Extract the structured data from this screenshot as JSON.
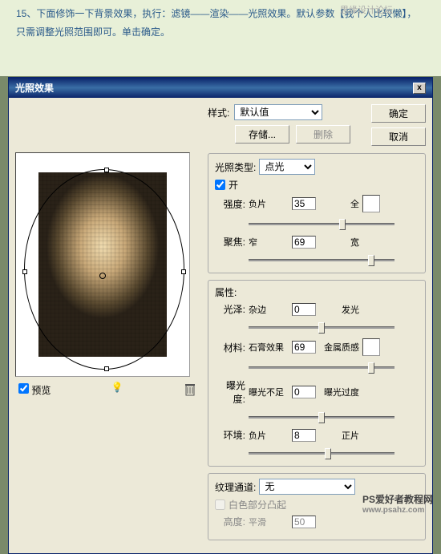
{
  "instruction_text": "15、下面修饰一下背景效果，执行：滤镜——渲染——光照效果。默认参数【我个人比较懒】，只需调整光照范围即可。单击确定。",
  "watermark_top": "思缘设计论坛",
  "dialog": {
    "title": "光照效果",
    "close": "x",
    "style_label": "样式:",
    "style_value": "默认值",
    "save_btn": "存储...",
    "delete_btn": "删除",
    "ok_btn": "确定",
    "cancel_btn": "取消",
    "light_type_label": "光照类型:",
    "light_type_value": "点光",
    "on_checkbox": "开",
    "intensity_label": "强度:",
    "intensity_left": "负片",
    "intensity_val": "35",
    "intensity_right": "全",
    "focus_label": "聚焦:",
    "focus_left": "窄",
    "focus_val": "69",
    "focus_right": "宽",
    "props_label": "属性:",
    "gloss_label": "光泽:",
    "gloss_left": "杂边",
    "gloss_val": "0",
    "gloss_right": "发光",
    "material_label": "材料:",
    "material_left": "石膏效果",
    "material_val": "69",
    "material_right": "金属质感",
    "exposure_label": "曝光度:",
    "exposure_left": "曝光不足",
    "exposure_val": "0",
    "exposure_right": "曝光过度",
    "ambience_label": "环境:",
    "ambience_left": "负片",
    "ambience_val": "8",
    "ambience_right": "正片",
    "texture_label": "纹理通道:",
    "texture_value": "无",
    "white_high": "白色部分凸起",
    "height_label": "高度:",
    "height_left": "平滑",
    "height_val": "50",
    "preview_checkbox": "预览"
  },
  "watermark_bottom": "PS爱好者教程网",
  "watermark_url": "www.psahz.com"
}
